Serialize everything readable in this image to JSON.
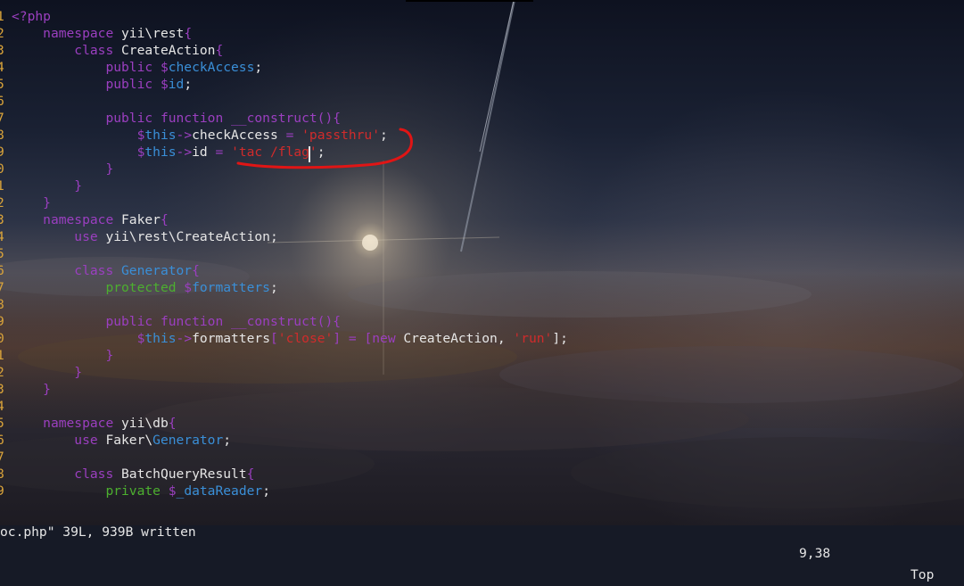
{
  "colors": {
    "keyword": "#9b3fc0",
    "plain": "#e6e6e6",
    "variable": "#3a8fd8",
    "string": "#d12b2b",
    "line_number": "#d9a33a",
    "annotation": "#e01515"
  },
  "editor": {
    "lines": [
      {
        "n": "1",
        "tokens": [
          {
            "t": "<?php",
            "c": "#9b3fc0"
          }
        ]
      },
      {
        "n": "2",
        "tokens": [
          {
            "t": "    "
          },
          {
            "t": "namespace",
            "c": "#9b3fc0"
          },
          {
            "t": " yii\\rest",
            "c": "#e6e6e6"
          },
          {
            "t": "{",
            "c": "#9b3fc0"
          }
        ]
      },
      {
        "n": "3",
        "tokens": [
          {
            "t": "        "
          },
          {
            "t": "class",
            "c": "#9b3fc0"
          },
          {
            "t": " CreateAction",
            "c": "#e6e6e6"
          },
          {
            "t": "{",
            "c": "#9b3fc0"
          }
        ]
      },
      {
        "n": "4",
        "tokens": [
          {
            "t": "            "
          },
          {
            "t": "public",
            "c": "#9b3fc0"
          },
          {
            "t": " $",
            "c": "#9b3fc0"
          },
          {
            "t": "checkAccess",
            "c": "#3a8fd8"
          },
          {
            "t": ";",
            "c": "#e6e6e6"
          }
        ]
      },
      {
        "n": "5",
        "tokens": [
          {
            "t": "            "
          },
          {
            "t": "public",
            "c": "#9b3fc0"
          },
          {
            "t": " $",
            "c": "#9b3fc0"
          },
          {
            "t": "id",
            "c": "#3a8fd8"
          },
          {
            "t": ";",
            "c": "#e6e6e6"
          }
        ]
      },
      {
        "n": "6",
        "tokens": []
      },
      {
        "n": "7",
        "tokens": [
          {
            "t": "            "
          },
          {
            "t": "public",
            "c": "#9b3fc0"
          },
          {
            "t": " function",
            "c": "#9b3fc0"
          },
          {
            "t": " __construct",
            "c": "#9b3fc0"
          },
          {
            "t": "(){",
            "c": "#9b3fc0"
          }
        ]
      },
      {
        "n": "8",
        "tokens": [
          {
            "t": "                "
          },
          {
            "t": "$",
            "c": "#9b3fc0"
          },
          {
            "t": "this",
            "c": "#3a8fd8"
          },
          {
            "t": "->",
            "c": "#9b3fc0"
          },
          {
            "t": "checkAccess",
            "c": "#e6e6e6"
          },
          {
            "t": " = ",
            "c": "#9b3fc0"
          },
          {
            "t": "'passthru'",
            "c": "#d12b2b"
          },
          {
            "t": ";",
            "c": "#e6e6e6"
          }
        ]
      },
      {
        "n": "9",
        "tokens": [
          {
            "t": "                "
          },
          {
            "t": "$",
            "c": "#9b3fc0"
          },
          {
            "t": "this",
            "c": "#3a8fd8"
          },
          {
            "t": "->",
            "c": "#9b3fc0"
          },
          {
            "t": "id",
            "c": "#e6e6e6"
          },
          {
            "t": " = ",
            "c": "#9b3fc0"
          },
          {
            "t": "'tac /flag'",
            "c": "#d12b2b"
          },
          {
            "t": ";",
            "c": "#e6e6e6"
          }
        ]
      },
      {
        "n": "0",
        "tokens": [
          {
            "t": "            "
          },
          {
            "t": "}",
            "c": "#9b3fc0"
          }
        ]
      },
      {
        "n": "1",
        "tokens": [
          {
            "t": "        "
          },
          {
            "t": "}",
            "c": "#9b3fc0"
          }
        ]
      },
      {
        "n": "2",
        "tokens": [
          {
            "t": "    "
          },
          {
            "t": "}",
            "c": "#9b3fc0"
          }
        ]
      },
      {
        "n": "3",
        "tokens": [
          {
            "t": "    "
          },
          {
            "t": "namespace",
            "c": "#9b3fc0"
          },
          {
            "t": " Faker",
            "c": "#e6e6e6"
          },
          {
            "t": "{",
            "c": "#9b3fc0"
          }
        ]
      },
      {
        "n": "4",
        "tokens": [
          {
            "t": "        "
          },
          {
            "t": "use",
            "c": "#9b3fc0"
          },
          {
            "t": " yii\\rest\\CreateAction",
            "c": "#e6e6e6"
          },
          {
            "t": ";",
            "c": "#e6e6e6"
          }
        ]
      },
      {
        "n": "5",
        "tokens": []
      },
      {
        "n": "6",
        "tokens": [
          {
            "t": "        "
          },
          {
            "t": "class",
            "c": "#9b3fc0"
          },
          {
            "t": " Generator",
            "c": "#3a8fd8"
          },
          {
            "t": "{",
            "c": "#9b3fc0"
          }
        ]
      },
      {
        "n": "7",
        "tokens": [
          {
            "t": "            "
          },
          {
            "t": "protected",
            "c": "#4caf2f"
          },
          {
            "t": " $",
            "c": "#9b3fc0"
          },
          {
            "t": "formatters",
            "c": "#3a8fd8"
          },
          {
            "t": ";",
            "c": "#e6e6e6"
          }
        ]
      },
      {
        "n": "8",
        "tokens": []
      },
      {
        "n": "9",
        "tokens": [
          {
            "t": "            "
          },
          {
            "t": "public",
            "c": "#9b3fc0"
          },
          {
            "t": " function",
            "c": "#9b3fc0"
          },
          {
            "t": " __construct",
            "c": "#9b3fc0"
          },
          {
            "t": "(){",
            "c": "#9b3fc0"
          }
        ]
      },
      {
        "n": "0",
        "tokens": [
          {
            "t": "                "
          },
          {
            "t": "$",
            "c": "#9b3fc0"
          },
          {
            "t": "this",
            "c": "#3a8fd8"
          },
          {
            "t": "->",
            "c": "#9b3fc0"
          },
          {
            "t": "formatters",
            "c": "#e6e6e6"
          },
          {
            "t": "[",
            "c": "#9b3fc0"
          },
          {
            "t": "'close'",
            "c": "#d12b2b"
          },
          {
            "t": "] = [",
            "c": "#9b3fc0"
          },
          {
            "t": "new",
            "c": "#9b3fc0"
          },
          {
            "t": " CreateAction, ",
            "c": "#e6e6e6"
          },
          {
            "t": "'run'",
            "c": "#d12b2b"
          },
          {
            "t": "];",
            "c": "#e6e6e6"
          }
        ]
      },
      {
        "n": "1",
        "tokens": [
          {
            "t": "            "
          },
          {
            "t": "}",
            "c": "#9b3fc0"
          }
        ]
      },
      {
        "n": "2",
        "tokens": [
          {
            "t": "        "
          },
          {
            "t": "}",
            "c": "#9b3fc0"
          }
        ]
      },
      {
        "n": "3",
        "tokens": [
          {
            "t": "    "
          },
          {
            "t": "}",
            "c": "#9b3fc0"
          }
        ]
      },
      {
        "n": "4",
        "tokens": []
      },
      {
        "n": "5",
        "tokens": [
          {
            "t": "    "
          },
          {
            "t": "namespace",
            "c": "#9b3fc0"
          },
          {
            "t": " yii\\db",
            "c": "#e6e6e6"
          },
          {
            "t": "{",
            "c": "#9b3fc0"
          }
        ]
      },
      {
        "n": "6",
        "tokens": [
          {
            "t": "        "
          },
          {
            "t": "use",
            "c": "#9b3fc0"
          },
          {
            "t": " Faker\\",
            "c": "#e6e6e6"
          },
          {
            "t": "Generator",
            "c": "#3a8fd8"
          },
          {
            "t": ";",
            "c": "#e6e6e6"
          }
        ]
      },
      {
        "n": "7",
        "tokens": []
      },
      {
        "n": "8",
        "tokens": [
          {
            "t": "        "
          },
          {
            "t": "class",
            "c": "#9b3fc0"
          },
          {
            "t": " BatchQueryResult",
            "c": "#e6e6e6"
          },
          {
            "t": "{",
            "c": "#9b3fc0"
          }
        ]
      },
      {
        "n": "9",
        "tokens": [
          {
            "t": "            "
          },
          {
            "t": "private",
            "c": "#4caf2f"
          },
          {
            "t": " $",
            "c": "#9b3fc0"
          },
          {
            "t": "_dataReader",
            "c": "#3a8fd8"
          },
          {
            "t": ";",
            "c": "#e6e6e6"
          }
        ]
      }
    ]
  },
  "statusbar": {
    "message": "oc.php\" 39L, 939B written",
    "position": "9,38",
    "scroll": "Top"
  }
}
